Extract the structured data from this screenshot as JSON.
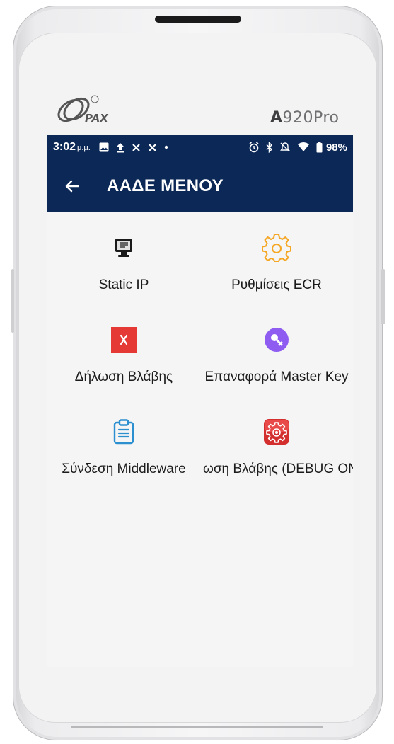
{
  "device": {
    "model_prefix": "A",
    "model_suffix": "920Pro",
    "brand": "PAX"
  },
  "statusbar": {
    "time": "3:02",
    "time_suffix": "μ.μ.",
    "battery": "98%",
    "left_icons": [
      "image-icon",
      "upload-icon",
      "muted-x-icon",
      "muted-x-icon",
      "dot-icon"
    ],
    "right_icons": [
      "alarm-icon",
      "bluetooth-icon",
      "vibrate-off-icon",
      "wifi-icon",
      "battery-icon"
    ]
  },
  "appbar": {
    "title": "ΑΑΔΕ ΜΕΝΟΥ",
    "back_icon": "arrow-left-icon"
  },
  "menu": {
    "items": [
      {
        "label": "Static IP",
        "icon": "monitor-icon"
      },
      {
        "label": "Ρυθμίσεις ECR",
        "icon": "gear-icon",
        "color": "#f5a623"
      },
      {
        "label": "Δήλωση Βλάβης",
        "icon": "x-mark-icon",
        "color": "#e53935"
      },
      {
        "label": "Επαναφορά Master Key",
        "icon": "key-icon",
        "color": "#8e5cf0"
      },
      {
        "label": "Σύνδεση Middleware",
        "icon": "clipboard-icon",
        "color": "#2c8fd0"
      },
      {
        "label": "ωση Βλάβης (DEBUG ONL",
        "icon": "red-gear-icon",
        "color": "#d32f2f"
      }
    ]
  },
  "colors": {
    "header": "#0b2857",
    "background": "#f5f5f5"
  }
}
